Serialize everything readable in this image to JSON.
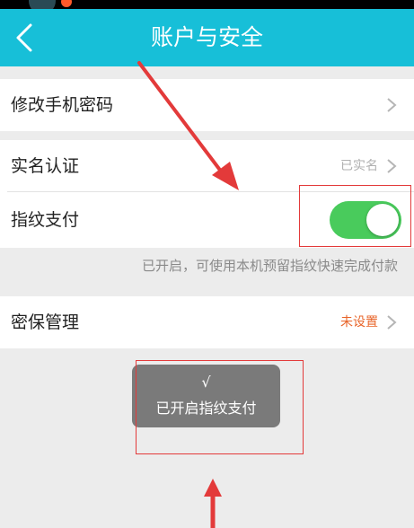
{
  "header": {
    "title": "账户与安全"
  },
  "rows": {
    "change_password": {
      "label": "修改手机密码"
    },
    "realname": {
      "label": "实名认证",
      "value": "已实名"
    },
    "fingerprint": {
      "label": "指纹支付",
      "toggle_on": true
    },
    "security_question": {
      "label": "密保管理",
      "value": "未设置"
    }
  },
  "hint": "已开启，可使用本机预留指纹快速完成付款",
  "toast": {
    "check": "√",
    "message": "已开启指纹支付"
  },
  "colors": {
    "header": "#17bfd8",
    "toggle_on": "#49cb5c",
    "unset_value": "#e8652a",
    "annotation": "#e33a3a"
  }
}
